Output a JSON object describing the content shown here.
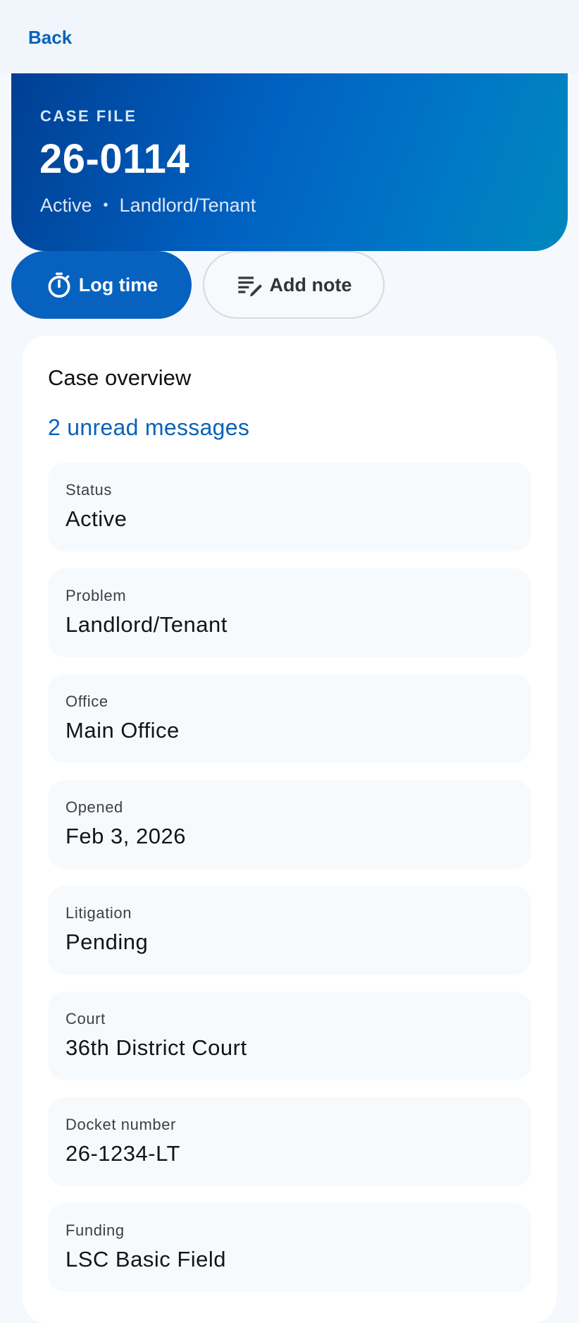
{
  "nav": {
    "back_label": "Back"
  },
  "hero": {
    "eyebrow": "CASE FILE",
    "case_number": "26-0114",
    "status": "Active",
    "separator": "•",
    "problem": "Landlord/Tenant"
  },
  "actions": {
    "log_time": {
      "label": "Log time",
      "icon": "timer-icon"
    },
    "add_note": {
      "label": "Add note",
      "icon": "edit-note-icon"
    }
  },
  "overview": {
    "title": "Case overview",
    "unread_link": "2 unread messages",
    "fields": [
      {
        "label": "Status",
        "value": "Active"
      },
      {
        "label": "Problem",
        "value": "Landlord/Tenant"
      },
      {
        "label": "Office",
        "value": "Main Office"
      },
      {
        "label": "Opened",
        "value": "Feb 3, 2026"
      },
      {
        "label": "Litigation",
        "value": "Pending"
      },
      {
        "label": "Court",
        "value": "36th District Court"
      },
      {
        "label": "Docket number",
        "value": "26-1234-LT"
      },
      {
        "label": "Funding",
        "value": "LSC Basic Field"
      }
    ]
  },
  "colors": {
    "accent": "#0a62b8",
    "primary_button": "#0762bf",
    "hero_start": "#003f93",
    "hero_end": "#0088bd",
    "page_background": "#f5f9fd"
  }
}
